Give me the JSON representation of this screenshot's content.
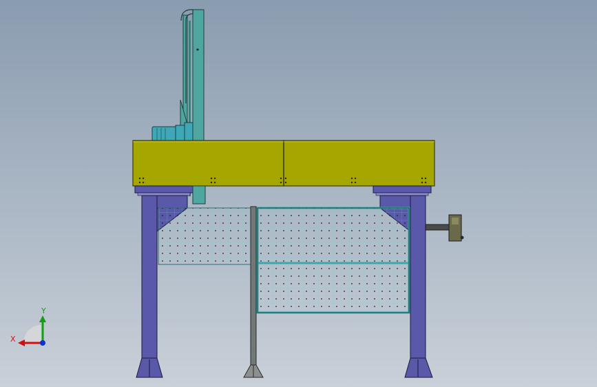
{
  "viewport": {
    "background_top": "#8a9cb0",
    "background_bottom": "#c9d0d8"
  },
  "model": {
    "beam_color": "#a6a600",
    "leg_color": "#5a58a8",
    "column_color": "#4fa6a0",
    "mesh_color": "#3aa8a8",
    "motor_color": "#3fa8b8",
    "gripper_color": "#6a6a4a"
  },
  "triad": {
    "x_label": "X",
    "y_label": "Y",
    "x_color": "#d01010",
    "y_color": "#10a010",
    "z_color": "#1030d0"
  }
}
